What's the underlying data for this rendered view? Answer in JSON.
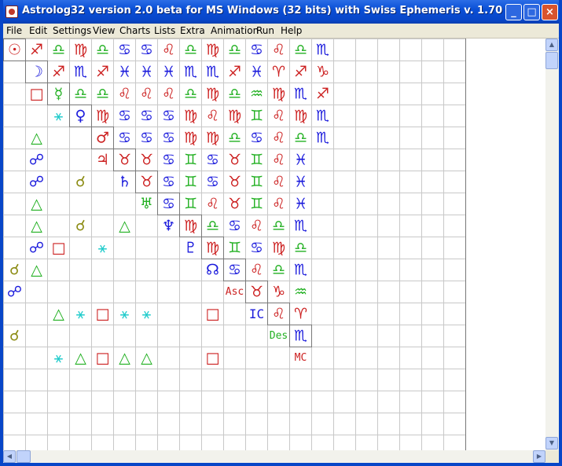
{
  "window": {
    "title": "Astrolog32 version 2.0 beta for MS Windows (32 bits) with Swiss Ephemeris v. 1.70",
    "icon": "astrolog-app-icon",
    "controls": {
      "minimize": "_",
      "maximize": "□",
      "close": "×"
    }
  },
  "menu": [
    "File",
    "Edit",
    "Settings",
    "View",
    "Charts",
    "Lists",
    "Extra",
    "Animation",
    "Run",
    "Help"
  ],
  "colors": {
    "blue": "#1a1adc",
    "red": "#cc2020",
    "green": "#22b022",
    "cyan": "#22cccc",
    "olive": "#8c8c14",
    "grid": "#c8c8c8",
    "gridDark": "#787878"
  },
  "glyphs": {
    "sun": "☉",
    "moon": "☽",
    "mercury": "☿",
    "venus": "♀",
    "mars": "♂",
    "jupiter": "♃",
    "saturn": "♄",
    "uranus": "♅",
    "neptune": "♆",
    "pluto": "♇",
    "node": "☊",
    "asc": "Asc",
    "ic": "IC",
    "des": "Des",
    "mc": "MC",
    "ari": "♈",
    "tau": "♉",
    "gem": "♊",
    "can": "♋",
    "leo": "♌",
    "vir": "♍",
    "lib": "♎",
    "sco": "♏",
    "sag": "♐",
    "cap": "♑",
    "aqu": "♒",
    "pis": "♓",
    "opposition": "☍",
    "conjunction": "☌",
    "trine": "△",
    "sextile": "⚹",
    "square": "□"
  },
  "grid": {
    "rows": [
      [
        "sun",
        "sag",
        "lib",
        "vir",
        "lib",
        "can",
        "can",
        "leo",
        "lib",
        "vir",
        "lib",
        "can",
        "leo",
        "lib",
        "sco"
      ],
      [
        "",
        "moon",
        "sag",
        "sco",
        "sag",
        "pis",
        "pis",
        "pis",
        "sco",
        "sco",
        "sag",
        "pis",
        "ari",
        "sag",
        "cap"
      ],
      [
        "",
        "square",
        "mercury",
        "lib",
        "lib",
        "leo",
        "leo",
        "leo",
        "lib",
        "vir",
        "lib",
        "aqu",
        "vir",
        "sco",
        "sag"
      ],
      [
        "",
        "",
        "sextile",
        "venus",
        "vir",
        "can",
        "can",
        "can",
        "vir",
        "leo",
        "vir",
        "gem",
        "leo",
        "vir",
        "sco"
      ],
      [
        "",
        "trine",
        "",
        "",
        "mars",
        "can",
        "can",
        "can",
        "vir",
        "vir",
        "lib",
        "can",
        "leo",
        "lib",
        "sco"
      ],
      [
        "",
        "opposition",
        "",
        "",
        "jupiter",
        "tau",
        "tau",
        "can",
        "gem",
        "can",
        "tau",
        "gem",
        "leo",
        "pis"
      ],
      [
        "",
        "opposition",
        "",
        "conjunction",
        "",
        "saturn",
        "tau",
        "can",
        "gem",
        "can",
        "tau",
        "gem",
        "leo",
        "pis"
      ],
      [
        "",
        "trine",
        "",
        "",
        "",
        "",
        "uranus",
        "can",
        "gem",
        "leo",
        "tau",
        "gem",
        "leo",
        "pis"
      ],
      [
        "",
        "trine",
        "",
        "conjunction",
        "",
        "trine",
        "",
        "neptune",
        "vir",
        "lib",
        "can",
        "leo",
        "lib",
        "sco"
      ],
      [
        "",
        "opposition",
        "square",
        "",
        "sextile",
        "",
        "",
        "",
        "pluto",
        "vir",
        "gem",
        "can",
        "vir",
        "lib"
      ],
      [
        "conjunction",
        "trine",
        "",
        "",
        "",
        "",
        "",
        "",
        "",
        "node",
        "can",
        "leo",
        "lib",
        "sco"
      ],
      [
        "opposition",
        "",
        "",
        "",
        "",
        "",
        "",
        "",
        "",
        "",
        "asc",
        "tau",
        "cap",
        "aqu"
      ],
      [
        "",
        "",
        "trine",
        "sextile",
        "square",
        "sextile",
        "sextile",
        "",
        "",
        "square",
        "",
        "ic",
        "leo",
        "ari"
      ],
      [
        "conjunction",
        "",
        "",
        "",
        "",
        "",
        "",
        "",
        "",
        "",
        "",
        "",
        "des",
        "sco"
      ],
      [
        "",
        "",
        "sextile",
        "trine",
        "square",
        "trine",
        "trine",
        "",
        "",
        "square",
        "",
        "",
        "",
        "mc"
      ]
    ]
  },
  "scrollbar": {
    "up": "▲",
    "down": "▼",
    "left": "◀",
    "right": "▶"
  }
}
